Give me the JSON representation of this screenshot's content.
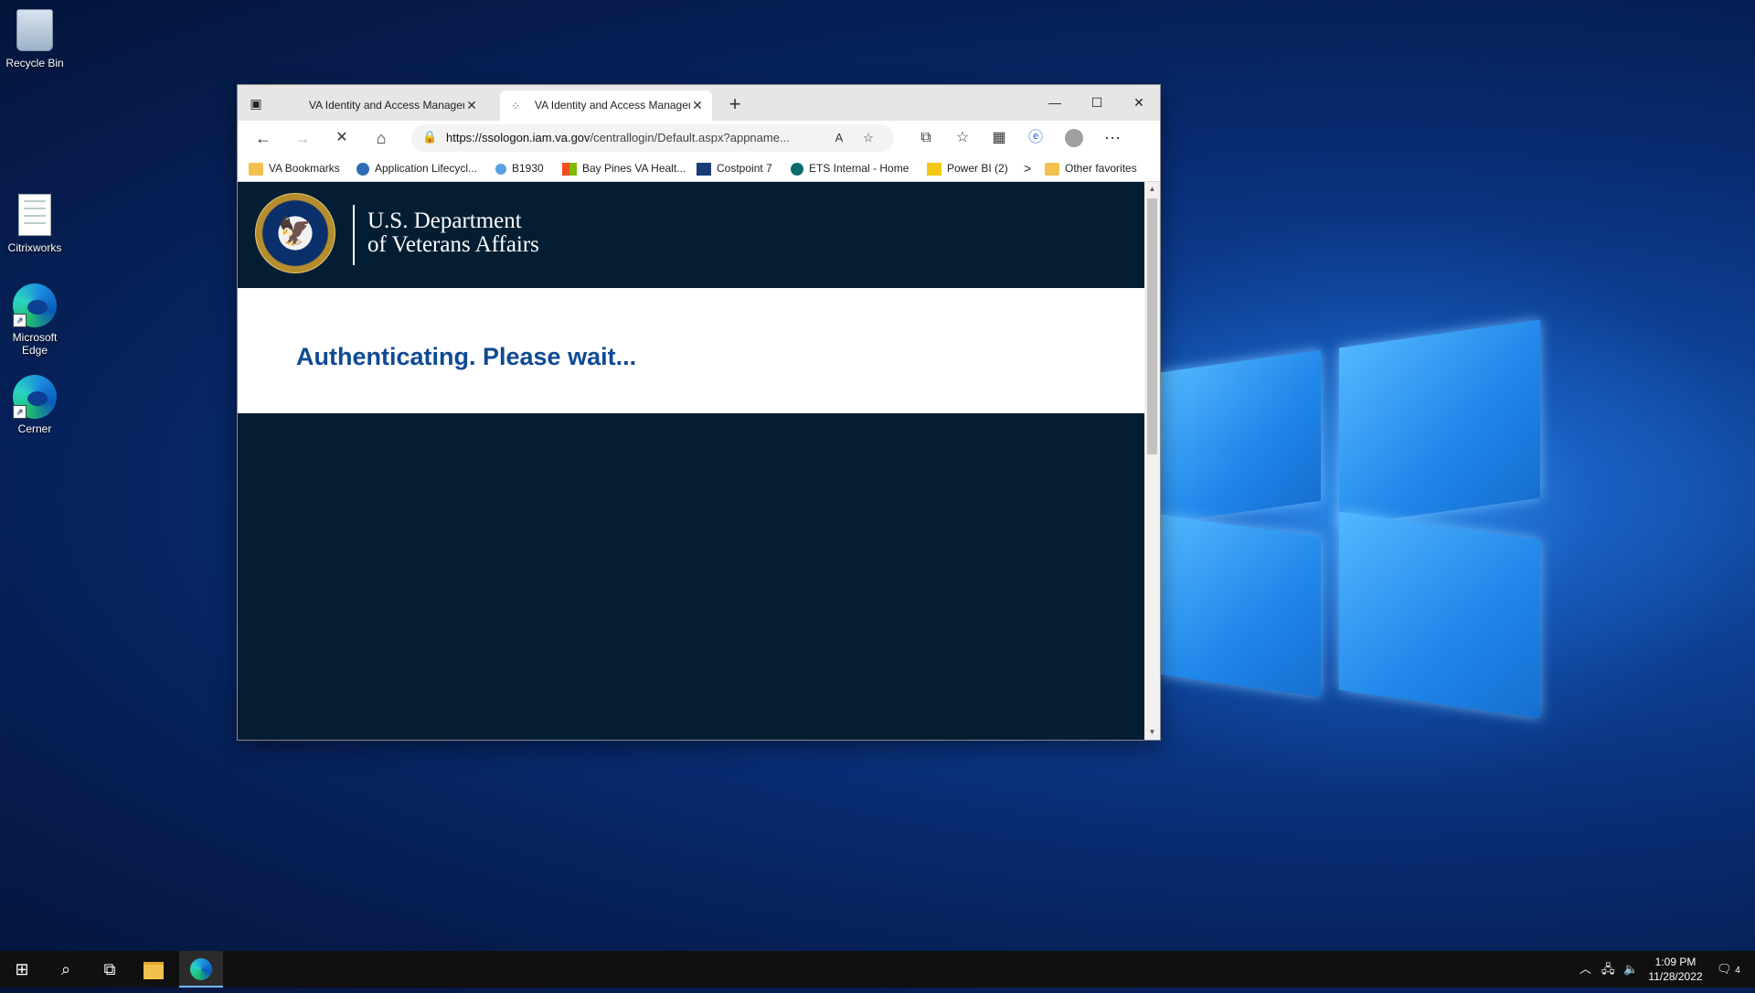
{
  "desktop": {
    "icons": [
      {
        "label": "Recycle Bin",
        "icon": "recycle-bin-icon"
      },
      {
        "label": "Citrixworks",
        "icon": "document-icon"
      },
      {
        "label": "Microsoft Edge",
        "icon": "edge-icon"
      },
      {
        "label": "Cerner",
        "icon": "edge-icon"
      }
    ]
  },
  "browser": {
    "tabs": [
      {
        "title": "VA Identity and Access Managem",
        "active": false
      },
      {
        "title": "VA Identity and Access Managem",
        "active": true
      }
    ],
    "new_tab_glyph": "+",
    "window_controls": {
      "minimize": "—",
      "maximize": "☐",
      "close": "✕"
    },
    "address": {
      "url_host": "https://ssologon.iam.va.gov",
      "url_path": "/centrallogin/Default.aspx?appname...",
      "read_aloud_glyph": "A"
    },
    "favorites": [
      {
        "label": "VA Bookmarks",
        "icon": "folder-icon"
      },
      {
        "label": "Application Lifecycl...",
        "icon": "app-lifecycle-icon"
      },
      {
        "label": "B1930",
        "icon": "b1930-icon"
      },
      {
        "label": "Bay Pines VA Healt...",
        "icon": "microsoft-icon"
      },
      {
        "label": "Costpoint 7",
        "icon": "costpoint-icon"
      },
      {
        "label": "ETS Internal - Home",
        "icon": "sharepoint-icon"
      },
      {
        "label": "Power BI (2)",
        "icon": "powerbi-icon"
      }
    ],
    "favorites_overflow_glyph": ">",
    "other_favorites": "Other favorites"
  },
  "page": {
    "dept_line1": "U.S. Department",
    "dept_line2": "of Veterans Affairs",
    "status": "Authenticating. Please wait..."
  },
  "taskbar": {
    "time": "1:09 PM",
    "date": "11/28/2022",
    "notification_count": "4"
  }
}
